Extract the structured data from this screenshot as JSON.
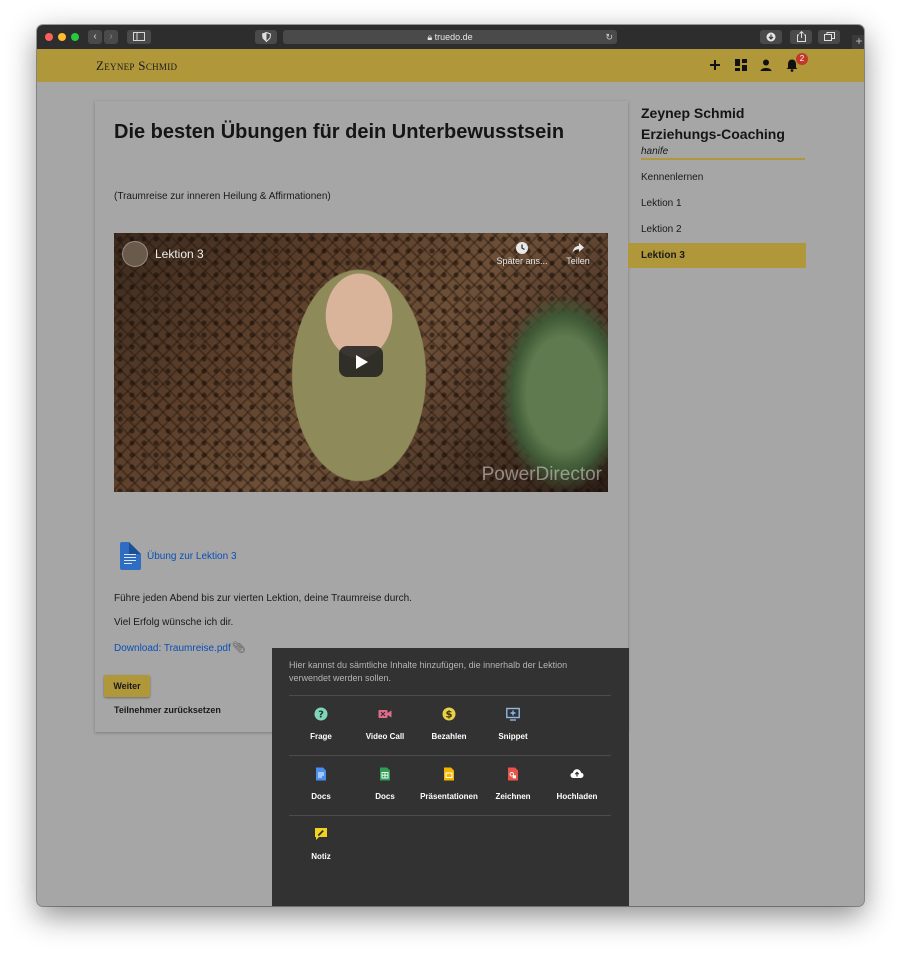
{
  "browser": {
    "url": "truedo.de",
    "back_glyph": "‹",
    "forward_glyph": "›",
    "reload_glyph": "↻",
    "newtab_glyph": "+"
  },
  "header": {
    "brand": "Zeynep Schmid",
    "notification_count": "2",
    "icons": [
      "plus-icon",
      "dashboard-icon",
      "user-icon",
      "bell-icon"
    ],
    "accent_color": "#b0973a"
  },
  "lesson": {
    "title": "Die besten Übungen für dein Unterbewusstsein",
    "subtitle": "(Traumreise zur inneren Heilung & Affirmationen)",
    "video": {
      "title": "Lektion 3",
      "watch_later": "Später ans...",
      "share": "Teilen",
      "watermark": "PowerDirector"
    },
    "document_link": "Übung zur Lektion 3",
    "paragraph_1": "Führe jeden Abend bis zur vierten Lektion, deine Traumreise durch.",
    "paragraph_2": "Viel Erfolg wünsche ich dir.",
    "download_link": "Download: Traumreise.pdf",
    "next_button": "Weiter",
    "reset_link": "Teilnehmer zurücksetzen"
  },
  "sidebar": {
    "title_line1": "Zeynep Schmid",
    "title_line2": "Erziehungs-Coaching",
    "subtitle": "hanife",
    "items": [
      {
        "label": "Kennenlernen",
        "active": false
      },
      {
        "label": "Lektion 1",
        "active": false
      },
      {
        "label": "Lektion 2",
        "active": false
      },
      {
        "label": "Lektion 3",
        "active": true
      }
    ]
  },
  "popup": {
    "hint": "Hier kannst du sämtliche Inhalte hinzufügen, die innerhalb der Lektion verwendet werden sollen.",
    "rows": [
      [
        {
          "label": "Frage",
          "icon": "question-icon",
          "color": "#7fd6b8"
        },
        {
          "label": "Video Call",
          "icon": "video-call-icon",
          "color": "#e26b8c"
        },
        {
          "label": "Bezahlen",
          "icon": "dollar-icon",
          "color": "#e7d24a"
        },
        {
          "label": "Snippet",
          "icon": "snippet-icon",
          "color": "#8fb8e6"
        }
      ],
      [
        {
          "label": "Docs",
          "icon": "google-docs-icon",
          "color": "#4a8ef0"
        },
        {
          "label": "Docs",
          "icon": "google-sheets-icon",
          "color": "#2f9e55"
        },
        {
          "label": "Präsentationen",
          "icon": "google-slides-icon",
          "color": "#f4b400"
        },
        {
          "label": "Zeichnen",
          "icon": "drawing-icon",
          "color": "#e8534a"
        },
        {
          "label": "Hochladen",
          "icon": "upload-cloud-icon",
          "color": "#ffffff"
        }
      ],
      [
        {
          "label": "Notiz",
          "icon": "note-icon",
          "color": "#f1d21d"
        }
      ]
    ]
  }
}
